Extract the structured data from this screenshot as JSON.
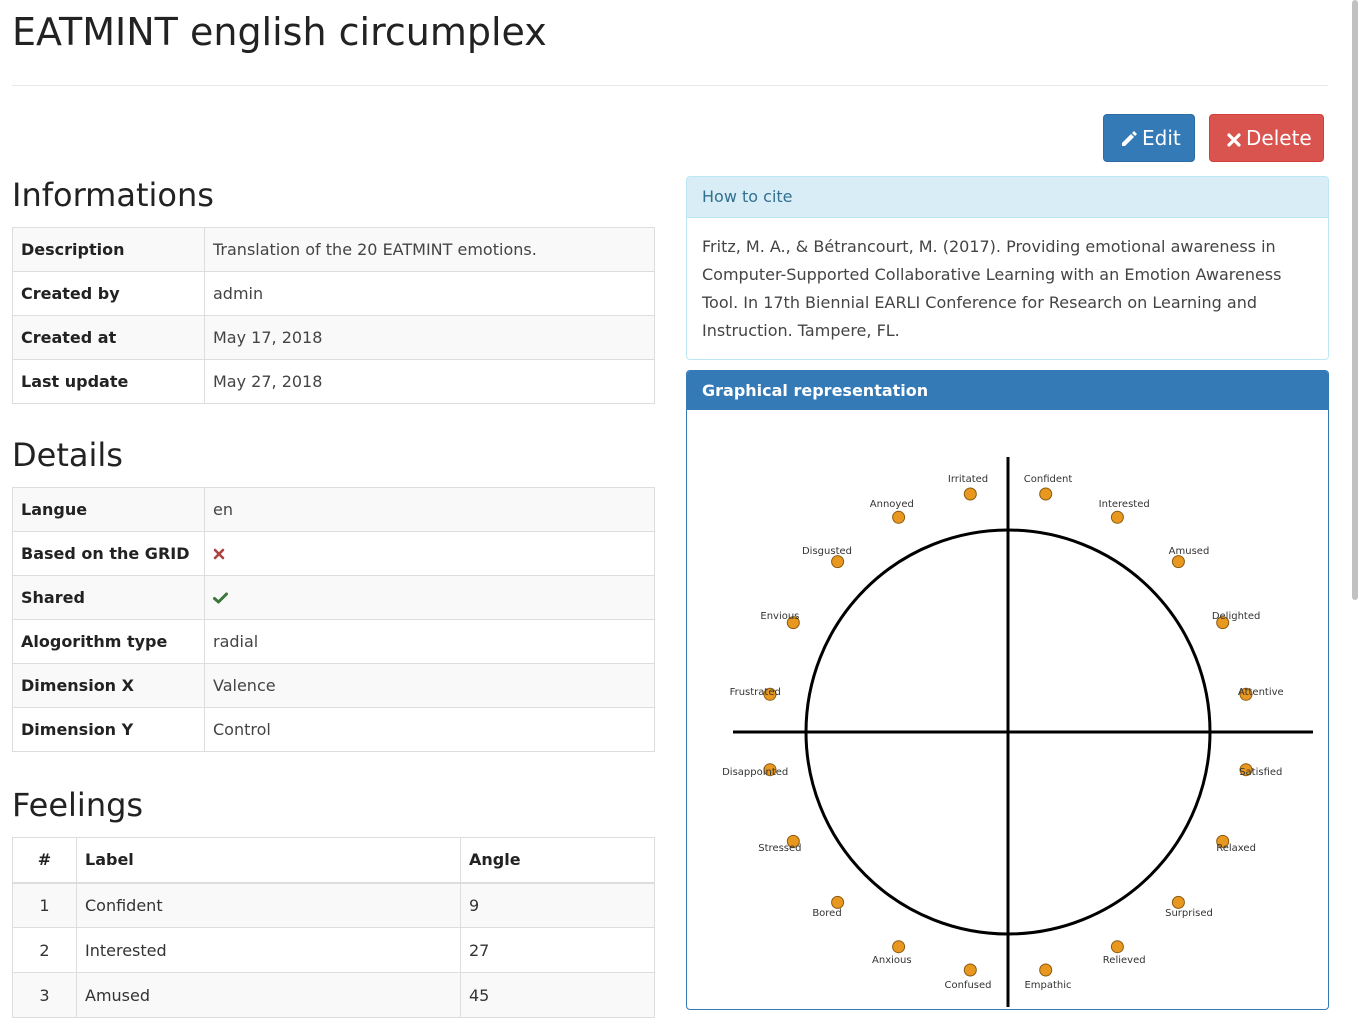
{
  "page": {
    "title": "EATMINT english circumplex"
  },
  "actions": {
    "edit_label": "Edit",
    "delete_label": "Delete"
  },
  "informations": {
    "heading": "Informations",
    "rows": [
      {
        "key": "Description",
        "value": "Translation of the 20 EATMINT emotions."
      },
      {
        "key": "Created by",
        "value": "admin"
      },
      {
        "key": "Created at",
        "value": "May 17, 2018"
      },
      {
        "key": "Last update",
        "value": "May 27, 2018"
      }
    ]
  },
  "details": {
    "heading": "Details",
    "rows": [
      {
        "key": "Langue",
        "value": "en"
      },
      {
        "key": "Based on the GRID",
        "value": "",
        "icon": "cross-icon",
        "icon_color": "#a94442"
      },
      {
        "key": "Shared",
        "value": "",
        "icon": "check-icon",
        "icon_color": "#3c763d"
      },
      {
        "key": "Alogorithm type",
        "value": "radial"
      },
      {
        "key": "Dimension X",
        "value": "Valence"
      },
      {
        "key": "Dimension Y",
        "value": "Control"
      }
    ]
  },
  "feelings": {
    "heading": "Feelings",
    "columns": [
      "#",
      "Label",
      "Angle"
    ],
    "rows": [
      {
        "num": "1",
        "label": "Confident",
        "angle": "9"
      },
      {
        "num": "2",
        "label": "Interested",
        "angle": "27"
      },
      {
        "num": "3",
        "label": "Amused",
        "angle": "45"
      }
    ]
  },
  "cite": {
    "heading": "How to cite",
    "text": "Fritz, M. A., & Bétrancourt, M. (2017). Providing emotional awareness in Computer-Supported Collaborative Learning with an Emotion Awareness Tool. In 17th Biennial EARLI Conference for Research on Learning and Instruction. Tampere, FL."
  },
  "graph": {
    "heading": "Graphical representation",
    "point_color": "#e8981f",
    "emotions": [
      {
        "label": "Confident",
        "angle": 9
      },
      {
        "label": "Interested",
        "angle": 27
      },
      {
        "label": "Amused",
        "angle": 45
      },
      {
        "label": "Delighted",
        "angle": 63
      },
      {
        "label": "Attentive",
        "angle": 81
      },
      {
        "label": "Satisfied",
        "angle": 99
      },
      {
        "label": "Relaxed",
        "angle": 117
      },
      {
        "label": "Surprised",
        "angle": 135
      },
      {
        "label": "Relieved",
        "angle": 153
      },
      {
        "label": "Empathic",
        "angle": 171
      },
      {
        "label": "Confused",
        "angle": 189
      },
      {
        "label": "Anxious",
        "angle": 207
      },
      {
        "label": "Bored",
        "angle": 225
      },
      {
        "label": "Stressed",
        "angle": 243
      },
      {
        "label": "Disappointed",
        "angle": 261
      },
      {
        "label": "Frustrated",
        "angle": 279
      },
      {
        "label": "Envious",
        "angle": 297
      },
      {
        "label": "Disgusted",
        "angle": 315
      },
      {
        "label": "Annoyed",
        "angle": 333
      },
      {
        "label": "Irritated",
        "angle": 351
      }
    ]
  }
}
